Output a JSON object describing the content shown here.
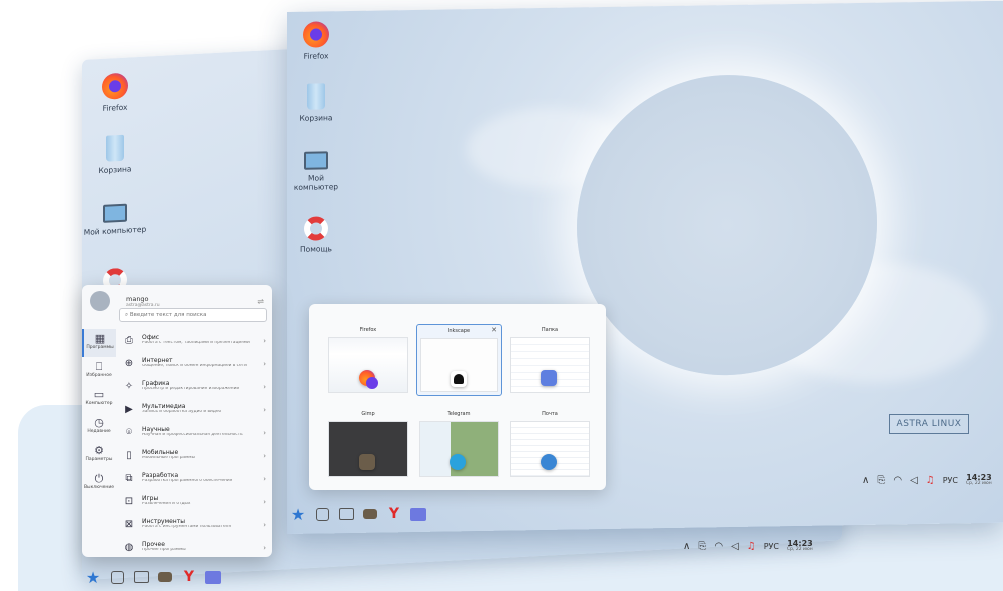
{
  "desktop_icons": {
    "firefox": "Firefox",
    "trash": "Корзина",
    "computer": "Мой компьютер",
    "help": "Помощь"
  },
  "start_menu": {
    "user": "mango",
    "email": "astra@astra.ru",
    "search_placeholder": "Введите текст для поиска",
    "sidebar": [
      "Программы",
      "Избранное",
      "Компьютер",
      "Недавние",
      "Параметры",
      "Выключение"
    ],
    "categories": [
      {
        "title": "Офис",
        "desc": "Работа с текстом, таблицами и презентациями"
      },
      {
        "title": "Интернет",
        "desc": "Общение, поиск и обмен информацией в сети"
      },
      {
        "title": "Графика",
        "desc": "Просмотр и редактирование изображений"
      },
      {
        "title": "Мультимедиа",
        "desc": "Запись и обработка аудио и видео"
      },
      {
        "title": "Научные",
        "desc": "Научная и профессиональная деятельность"
      },
      {
        "title": "Мобильные",
        "desc": "Мобильные программы"
      },
      {
        "title": "Разработка",
        "desc": "Разработка программного обеспечения"
      },
      {
        "title": "Игры",
        "desc": "Развлечения и отдых"
      },
      {
        "title": "Инструменты",
        "desc": "Работа с инструментами пользователя"
      },
      {
        "title": "Прочее",
        "desc": "Прочие программы"
      }
    ]
  },
  "switcher": {
    "windows": [
      "Firefox",
      "Inkscape",
      "Папка",
      "Gimp",
      "Telegram",
      "Почта"
    ],
    "selected": "Inkscape"
  },
  "taskbar": {
    "lang": "РУС",
    "time": "14:23",
    "date": "Ср, 22 июн"
  },
  "brand": "ASTRA LINUX"
}
